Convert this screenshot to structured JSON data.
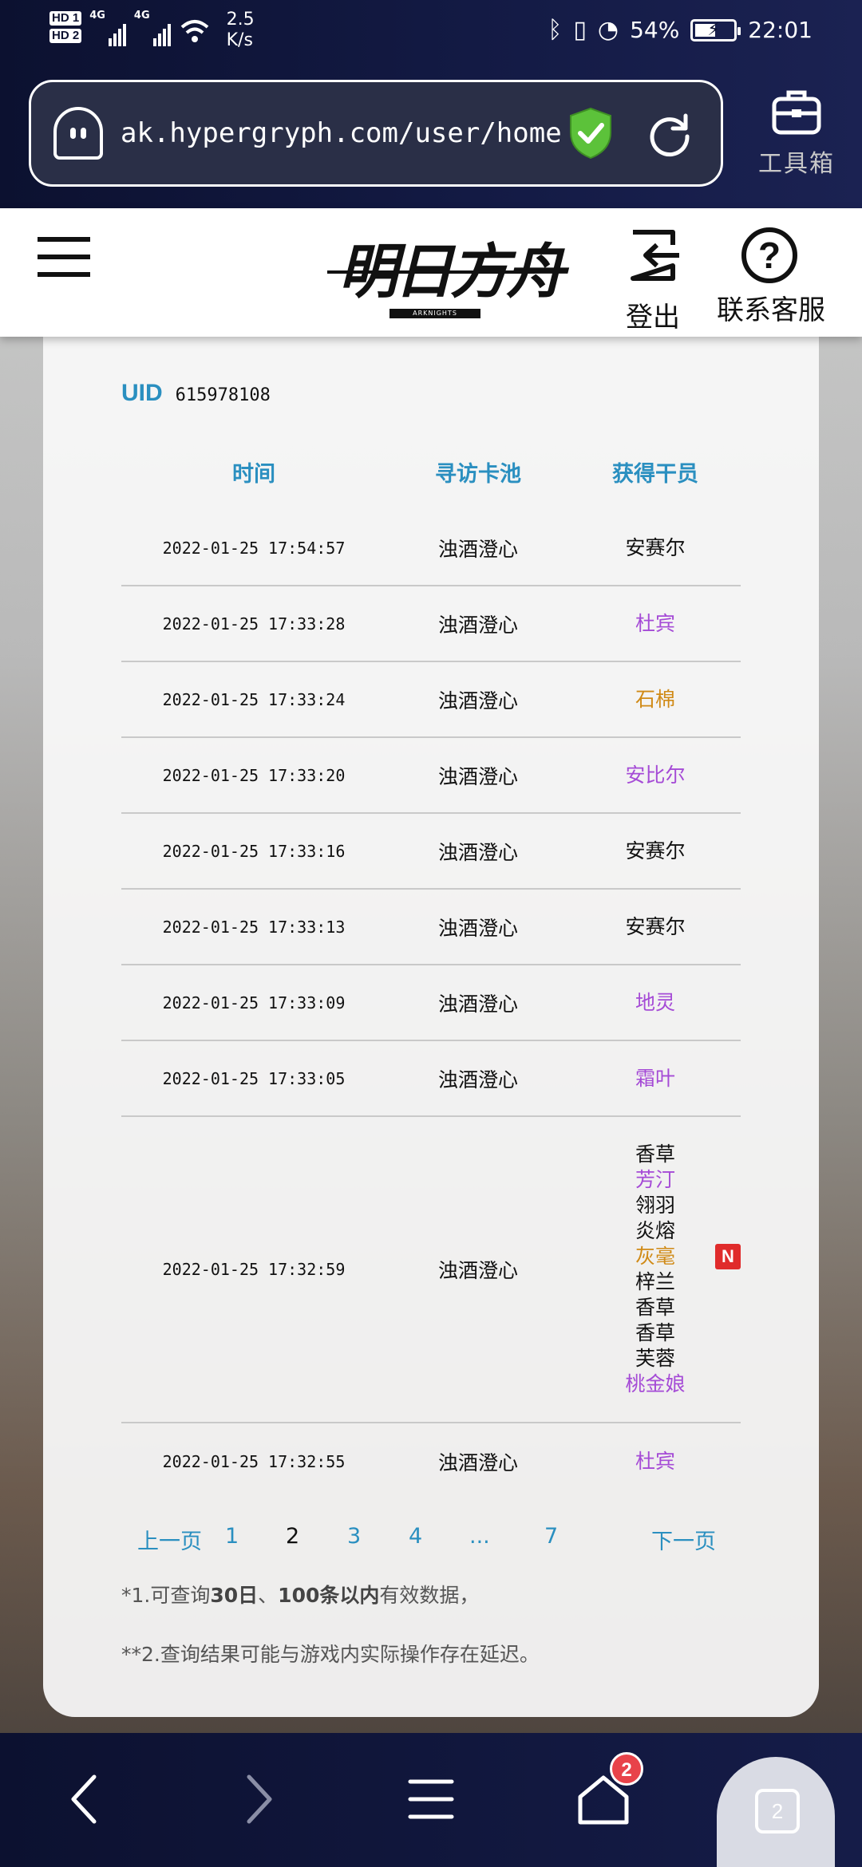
{
  "status_bar": {
    "hd1": "HD 1",
    "hd2": "HD 2",
    "network": "4G",
    "net_speed_value": "2.5",
    "net_speed_unit": "K/s",
    "battery_percent": "54%",
    "battery_level": 0.54,
    "time": "22:01"
  },
  "browser": {
    "url": "ak.hypergryph.com/user/home",
    "toolbox_label": "工具箱"
  },
  "header": {
    "logo_text": "明日方舟",
    "logo_subtext": "ARKNIGHTS",
    "logout_label": "登出",
    "support_label": "联系客服"
  },
  "uid": {
    "label": "UID",
    "value": "615978108"
  },
  "table": {
    "headers": [
      "时间",
      "寻访卡池",
      "获得干员"
    ],
    "rows": [
      {
        "time": "2022-01-25 17:54:57",
        "pool": "浊酒澄心",
        "operators": [
          {
            "name": "安赛尔",
            "color": "#111111"
          }
        ]
      },
      {
        "time": "2022-01-25 17:33:28",
        "pool": "浊酒澄心",
        "operators": [
          {
            "name": "杜宾",
            "color": "#a54bd6"
          }
        ]
      },
      {
        "time": "2022-01-25 17:33:24",
        "pool": "浊酒澄心",
        "operators": [
          {
            "name": "石棉",
            "color": "#d08a16"
          }
        ]
      },
      {
        "time": "2022-01-25 17:33:20",
        "pool": "浊酒澄心",
        "operators": [
          {
            "name": "安比尔",
            "color": "#a54bd6"
          }
        ]
      },
      {
        "time": "2022-01-25 17:33:16",
        "pool": "浊酒澄心",
        "operators": [
          {
            "name": "安赛尔",
            "color": "#111111"
          }
        ]
      },
      {
        "time": "2022-01-25 17:33:13",
        "pool": "浊酒澄心",
        "operators": [
          {
            "name": "安赛尔",
            "color": "#111111"
          }
        ]
      },
      {
        "time": "2022-01-25 17:33:09",
        "pool": "浊酒澄心",
        "operators": [
          {
            "name": "地灵",
            "color": "#a54bd6"
          }
        ]
      },
      {
        "time": "2022-01-25 17:33:05",
        "pool": "浊酒澄心",
        "operators": [
          {
            "name": "霜叶",
            "color": "#a54bd6"
          }
        ]
      },
      {
        "time": "2022-01-25 17:32:59",
        "pool": "浊酒澄心",
        "operators": [
          {
            "name": "香草",
            "color": "#111111"
          },
          {
            "name": "芳汀",
            "color": "#a54bd6"
          },
          {
            "name": "翎羽",
            "color": "#111111"
          },
          {
            "name": "炎熔",
            "color": "#111111"
          },
          {
            "name": "灰毫",
            "color": "#d08a16",
            "badge": "N"
          },
          {
            "name": "梓兰",
            "color": "#111111"
          },
          {
            "name": "香草",
            "color": "#111111"
          },
          {
            "name": "香草",
            "color": "#111111"
          },
          {
            "name": "芙蓉",
            "color": "#111111"
          },
          {
            "name": "桃金娘",
            "color": "#a54bd6"
          }
        ]
      },
      {
        "time": "2022-01-25 17:32:55",
        "pool": "浊酒澄心",
        "operators": [
          {
            "name": "杜宾",
            "color": "#a54bd6"
          }
        ]
      }
    ]
  },
  "pagination": {
    "prev": "上一页",
    "pages": [
      "1",
      "2",
      "3",
      "4",
      "...",
      "7"
    ],
    "current": "2",
    "next": "下一页"
  },
  "notes": {
    "note1_prefix": "*1.可查询",
    "note1_bold1": "30日",
    "note1_sep": "、",
    "note1_bold2": "100条以内",
    "note1_suffix": "有效数据，",
    "note2": "**2.查询结果可能与游戏内实际操作存在延迟。"
  },
  "bottom_nav": {
    "home_badge": "2",
    "tabs_count": "2"
  },
  "colors": {
    "accent": "#2a8fc0",
    "rare_purple": "#a54bd6",
    "rare_gold": "#d08a16",
    "new_badge": "#e02b2b",
    "chrome": "#0c1130"
  }
}
